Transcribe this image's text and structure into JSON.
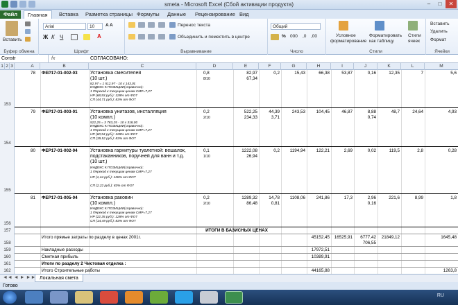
{
  "window": {
    "title": "smeta  -  Microsoft Excel (Сбой активации продукта)"
  },
  "ribbon_tabs": [
    "Файл",
    "Главная",
    "Вставка",
    "Разметка страницы",
    "Формулы",
    "Данные",
    "Рецензирование",
    "Вид"
  ],
  "ribbon": {
    "paste": "Вставить",
    "clipboard": "Буфер обмена",
    "font_name": "Arial",
    "font_size": "10",
    "font_group": "Шрифт",
    "wrap_text": "Перенос текста",
    "merge_center": "Объединить и поместить в центре",
    "alignment": "Выравнивание",
    "number_format": "Общий",
    "number": "Число",
    "cond_format_1": "Условное",
    "cond_format_2": "форматирование",
    "format_table_1": "Форматировать",
    "format_table_2": "как таблицу",
    "cell_styles_1": "Стили",
    "cell_styles_2": "ячеек",
    "styles": "Стили",
    "insert": "Вставить",
    "delete": "Удалить",
    "format": "Формат",
    "cells": "Ячейки",
    "outline_levels": [
      "1",
      "2",
      "3"
    ]
  },
  "formula_bar": {
    "name_box": "Constr",
    "fx": "fx",
    "content": "СОГЛАСОВАНО:"
  },
  "columns": [
    "A",
    "B",
    "C",
    "D",
    "E",
    "F",
    "G",
    "H",
    "I",
    "J",
    "K",
    "L",
    "M"
  ],
  "rows": [
    {
      "num": "153",
      "n": "78",
      "code": "ФЕР17-01-002-03",
      "name": [
        "Установка смесителей",
        "(10 шт.)"
      ],
      "sub": [
        "82,97 = 1 512,97 - 10 х 143,00",
        "ИНДЕКС К ПОЗИЦИИ(справочно):",
        "1 Переход к текущим ценам СМР=7,27",
        "НР (68,93 руб.): 128% от ФОТ",
        "СП (44,71 руб.): 83% от ФОТ"
      ],
      "qty": "0,8",
      "qty2": "8/10",
      "e": "82,97",
      "e2": "67,34",
      "f": "",
      "g": "0,2",
      "h": "15,43",
      "i": "66,38",
      "j": "53,87",
      "k": "0,16",
      "l": "12,35",
      "m": "7",
      "m2": "5,6"
    },
    {
      "num": "154",
      "n": "79",
      "code": "ФЕР17-01-003-01",
      "name": [
        "Установка унитазов, инсталляция",
        "(10 компл.)"
      ],
      "sub": [
        "522,25 = 3 783,25 - 10 х 318,00",
        "ИНДЕКС К ПОЗИЦИИ(справочно):",
        "1 Переход к текущим ценам СМР=7,27",
        "НР (60,94 руб.): 128% от ФОТ",
        "СП (39,52 руб.): 83% от ФОТ"
      ],
      "qty": "0,2",
      "qty2": "2/10",
      "e": "522,25",
      "e2": "234,33",
      "f": "44,39",
      "f2": "3,71",
      "g": "243,53",
      "h": "104,45",
      "i": "46,87",
      "j": "8,88",
      "j2": "0,74",
      "k": "48,7",
      "l": "24,64",
      "m": "4,93"
    },
    {
      "num": "155",
      "n": "80",
      "code": "ФЕР17-01-002-04",
      "name": [
        "Установка гарнитуры туалетной: вешалок,",
        "подстаканников, поручней для ванн и т.д.",
        "(10 шт.)"
      ],
      "sub": [
        "ИНДЕКС К ПОЗИЦИИ(справочно):",
        "1 Переход к текущим ценам СМР=7,27",
        "НР (1,44 руб.): 128% от ФОТ",
        "СП (2,22 руб.): 83% от ФОТ"
      ],
      "qty": "0,1",
      "qty2": "1/10",
      "e": "1222,08",
      "e2": "26,94",
      "f": "",
      "g": "0,2",
      "h": "1194,94",
      "i": "122,21",
      "j": "2,69",
      "k": "0,02",
      "l": "119,5",
      "m": "2,8",
      "m2": "0,28"
    },
    {
      "num": "156",
      "n": "81",
      "code": "ФЕР17-01-005-04",
      "name": [
        "Установка раковин",
        "(10 компл.)"
      ],
      "sub": [
        "ИНДЕКС К ПОЗИЦИИ(справочно):",
        "1 Переход к текущим ценам СМР=7,27",
        "НР (22,35 руб.): 128% от ФОТ",
        "СП (14,49 руб.): 83% от ФОТ"
      ],
      "qty": "0,2",
      "qty2": "2/10",
      "e": "1289,32",
      "e2": "86,48",
      "f": "14,78",
      "f2": "0,81",
      "g": "1108,06",
      "h": "241,86",
      "i": "17,3",
      "j": "2,96",
      "j2": "0,16",
      "k": "221,6",
      "l": "8,99",
      "m": "1,8"
    }
  ],
  "summary": {
    "r157_num": "157",
    "r157": "ИТОГИ В БАЗИСНЫХ ЦЕНАХ",
    "r158_num": "158",
    "r158": "Итого прямые затраты по разделу в ценах 2001г.",
    "r158_h": "45152,45",
    "r158_i": "16525,91",
    "r158_j": "6777,42",
    "r158_j2": "706,55",
    "r158_k": "21849,12",
    "r158_m": "1645,48",
    "r159_num": "159",
    "r159": "Накладные расходы",
    "r159_h": "17972,51",
    "r160_num": "160",
    "r160": "Сметная прибыль",
    "r160_h": "10389,91",
    "r161_num": "161",
    "r161": "Итоги по разделу 2 Чистовая отделка :",
    "r162_num": "162",
    "r162": "Итого Строительные работы",
    "r162_h": "44165,88",
    "r162_m": "1263,8"
  },
  "sheet_tab": "Локальная смета",
  "status": "Готово",
  "taskbar": {
    "lang": "RU"
  }
}
